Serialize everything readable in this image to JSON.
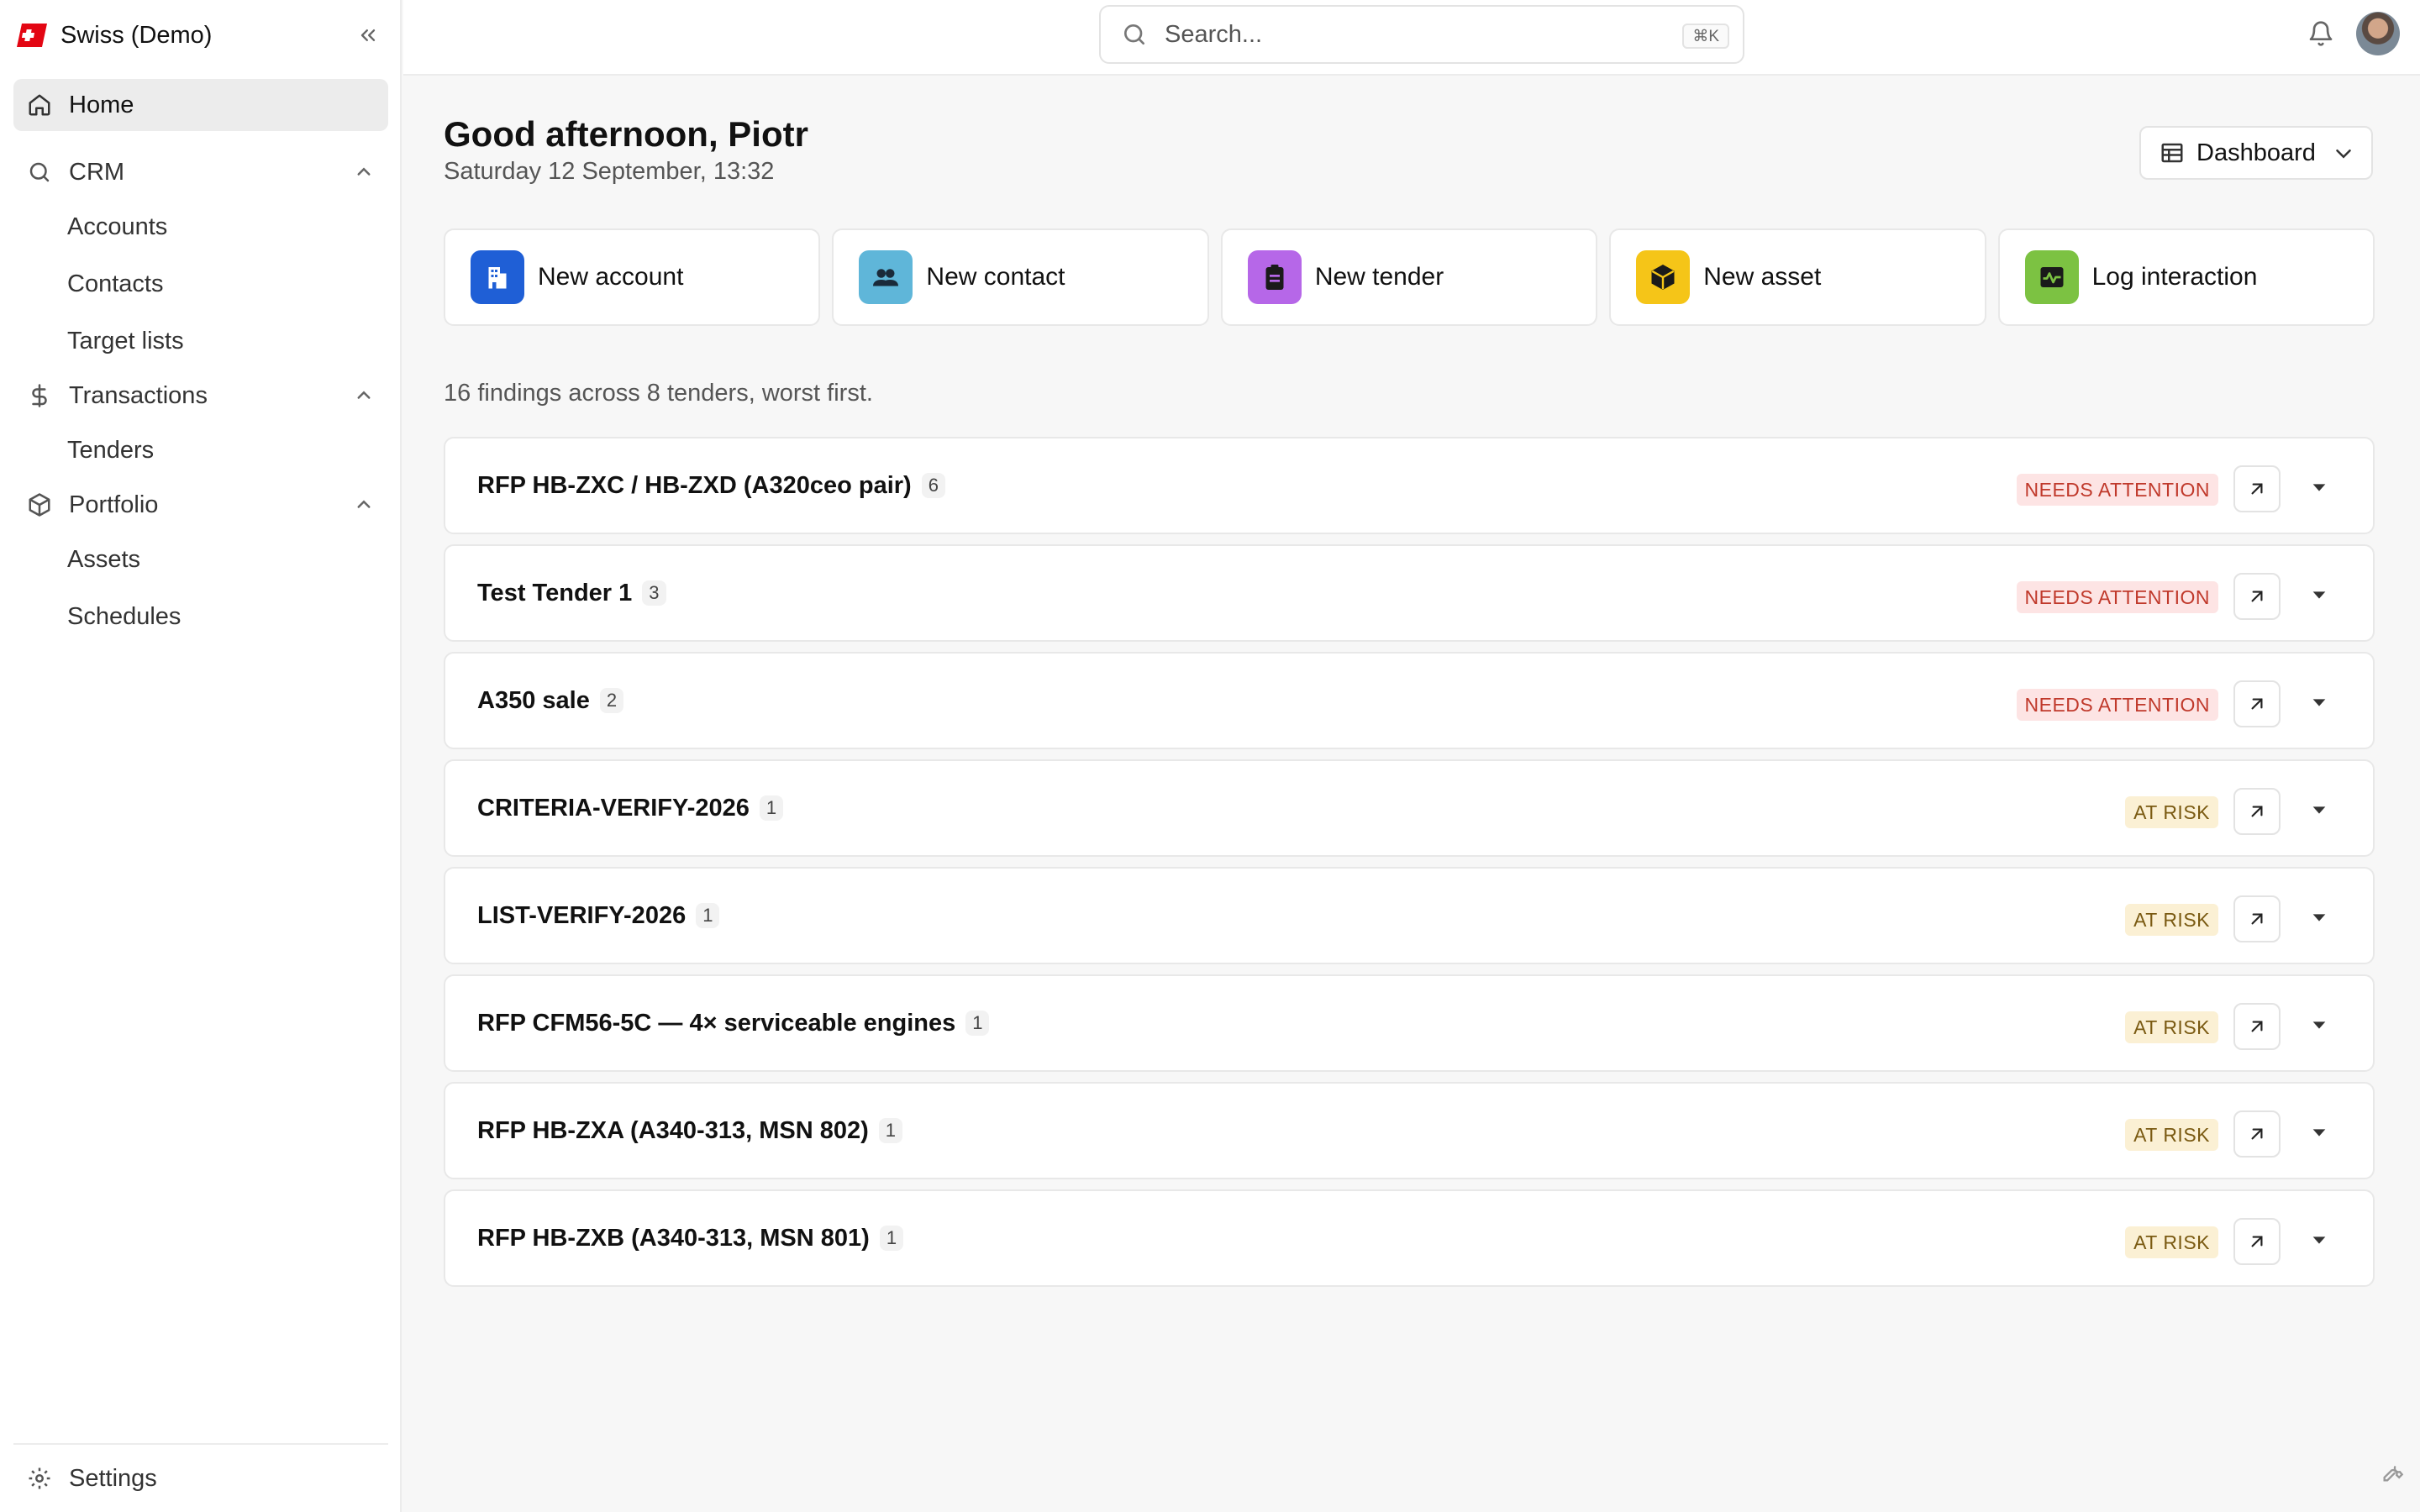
{
  "brand": {
    "name": "Swiss (Demo)",
    "logo_icon": "swiss-logo-icon",
    "accent": "#e30613"
  },
  "nav": {
    "home": "Home",
    "crm": {
      "label": "CRM",
      "items": [
        "Accounts",
        "Contacts",
        "Target lists"
      ]
    },
    "transactions": {
      "label": "Transactions",
      "items": [
        "Tenders"
      ]
    },
    "portfolio": {
      "label": "Portfolio",
      "items": [
        "Assets",
        "Schedules"
      ]
    },
    "settings": "Settings"
  },
  "search": {
    "placeholder": "Search...",
    "shortcut": "⌘K"
  },
  "header": {
    "greeting": "Good afternoon, Piotr",
    "date": "Saturday 12 September, 13:32",
    "view_label": "Dashboard"
  },
  "actions": [
    {
      "label": "New account",
      "icon": "building-icon",
      "color": "#1f5fd6"
    },
    {
      "label": "New contact",
      "icon": "users-icon",
      "color": "#5fb6d9"
    },
    {
      "label": "New tender",
      "icon": "clipboard-icon",
      "color": "#b667e8"
    },
    {
      "label": "New asset",
      "icon": "box-icon",
      "color": "#f5c518"
    },
    {
      "label": "Log interaction",
      "icon": "activity-icon",
      "color": "#7cc242"
    }
  ],
  "summary": "16 findings across 8 tenders, worst first.",
  "findings": [
    {
      "title": "RFP HB-ZXC / HB-ZXD (A320ceo pair)",
      "count": "6",
      "status": "NEEDS ATTENTION"
    },
    {
      "title": "Test Tender 1",
      "count": "3",
      "status": "NEEDS ATTENTION"
    },
    {
      "title": "A350 sale",
      "count": "2",
      "status": "NEEDS ATTENTION"
    },
    {
      "title": "CRITERIA-VERIFY-2026",
      "count": "1",
      "status": "AT RISK"
    },
    {
      "title": "LIST-VERIFY-2026",
      "count": "1",
      "status": "AT RISK"
    },
    {
      "title": "RFP CFM56-5C — 4× serviceable engines",
      "count": "1",
      "status": "AT RISK"
    },
    {
      "title": "RFP HB-ZXA (A340-313, MSN 802)",
      "count": "1",
      "status": "AT RISK"
    },
    {
      "title": "RFP HB-ZXB (A340-313, MSN 801)",
      "count": "1",
      "status": "AT RISK"
    }
  ],
  "status_colors": {
    "needs_attention": "#c0392b",
    "at_risk": "#7a5a12"
  }
}
